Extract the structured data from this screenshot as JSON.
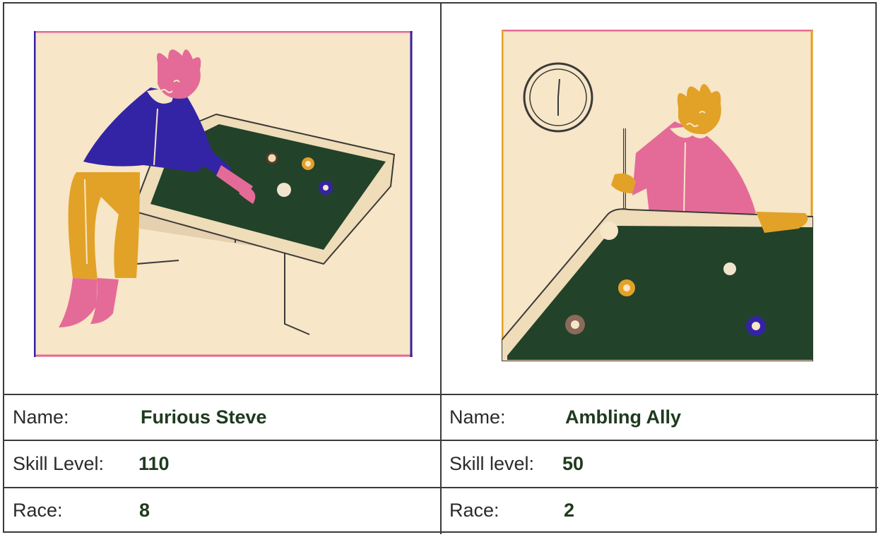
{
  "players": [
    {
      "name_label": "Name:",
      "name": "Furious Steve",
      "skill_label": "Skill Level:",
      "skill": "110",
      "race_label": "Race:",
      "race": "8"
    },
    {
      "name_label": "Name:",
      "name": "Ambling Ally",
      "skill_label": "Skill level:",
      "skill": "50",
      "race_label": "Race:",
      "race": "2"
    }
  ],
  "colors": {
    "background_cream": "#f7e6c7",
    "felt_green": "#22422a",
    "pink": "#e46b98",
    "blue": "#3324a6",
    "mustard": "#e2a227",
    "text_green": "#1f3a1f"
  }
}
